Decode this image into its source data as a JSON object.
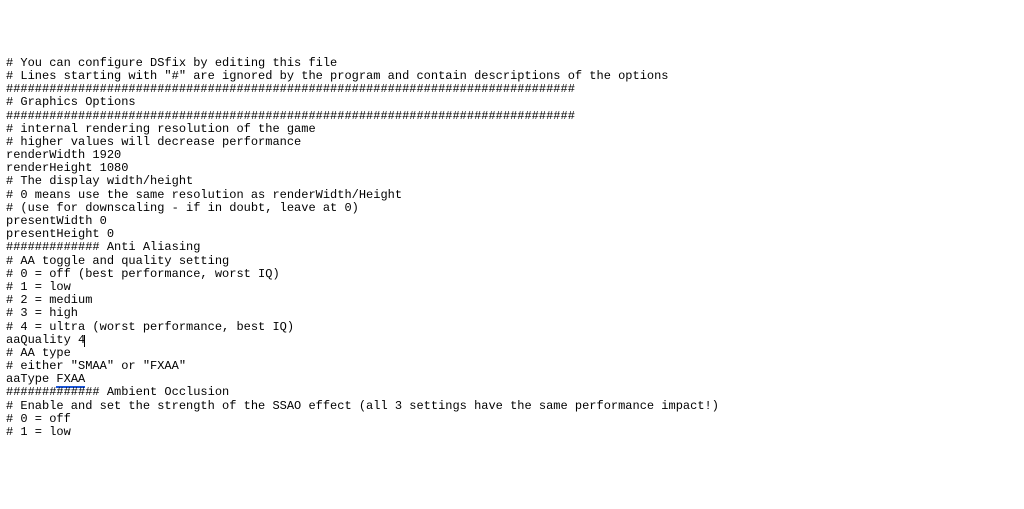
{
  "lines": [
    {
      "text": "# You can configure DSfix by editing this file"
    },
    {
      "text": "# Lines starting with \"#\" are ignored by the program and contain descriptions of the options"
    },
    {
      "text": ""
    },
    {
      "text": "###############################################################################"
    },
    {
      "text": "# Graphics Options"
    },
    {
      "text": "###############################################################################"
    },
    {
      "text": ""
    },
    {
      "text": "# internal rendering resolution of the game"
    },
    {
      "text": "# higher values will decrease performance"
    },
    {
      "text": "renderWidth 1920"
    },
    {
      "text": "renderHeight 1080"
    },
    {
      "text": ""
    },
    {
      "text": "# The display width/height"
    },
    {
      "text": "# 0 means use the same resolution as renderWidth/Height"
    },
    {
      "text": "# (use for downscaling - if in doubt, leave at 0)"
    },
    {
      "text": "presentWidth 0"
    },
    {
      "text": "presentHeight 0"
    },
    {
      "text": ""
    },
    {
      "text": "############# Anti Aliasing"
    },
    {
      "text": ""
    },
    {
      "text": "# AA toggle and quality setting"
    },
    {
      "text": "# 0 = off (best performance, worst IQ)"
    },
    {
      "text": "# 1 = low"
    },
    {
      "text": "# 2 = medium"
    },
    {
      "text": "# 3 = high"
    },
    {
      "text": "# 4 = ultra (worst performance, best IQ)"
    },
    {
      "text": "aaQuality 4",
      "caret": true
    },
    {
      "text": ""
    },
    {
      "text": "# AA type"
    },
    {
      "text": "# either \"SMAA\" or \"FXAA\""
    },
    {
      "text": "aaType ",
      "squiggle": "FXAA"
    },
    {
      "text": ""
    },
    {
      "text": "############# Ambient Occlusion"
    },
    {
      "text": ""
    },
    {
      "text": "# Enable and set the strength of the SSAO effect (all 3 settings have the same performance impact!)"
    },
    {
      "text": "# 0 = off"
    },
    {
      "text": "# 1 = low"
    }
  ]
}
